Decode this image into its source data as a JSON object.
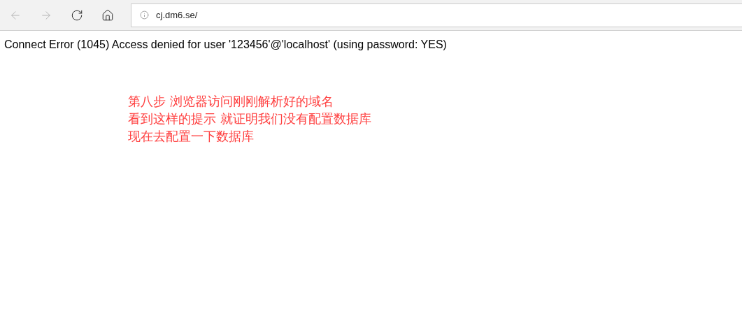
{
  "toolbar": {
    "nav_buttons": [
      {
        "kind": "back",
        "disabled": true
      },
      {
        "kind": "forward",
        "disabled": true
      },
      {
        "kind": "reload",
        "disabled": false
      },
      {
        "kind": "home",
        "disabled": false
      }
    ],
    "address": "cj.dm6.se/"
  },
  "page": {
    "error": "Connect Error (1045) Access denied for user '123456'@'localhost' (using password: YES)",
    "annotation": [
      "第八步 浏览器访问刚刚解析好的域名",
      "看到这样的提示 就证明我们没有配置数据库",
      "现在去配置一下数据库"
    ]
  }
}
